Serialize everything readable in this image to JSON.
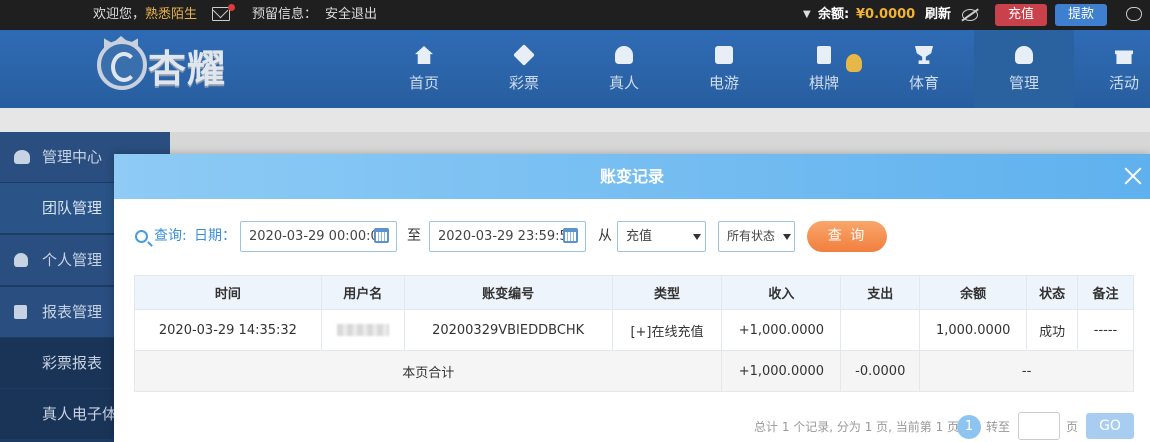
{
  "topbar": {
    "welcome": "欢迎您，",
    "username": "熟悉陌生",
    "reserved_info": "预留信息：",
    "logout": "安全退出",
    "balance_label": "余额:",
    "balance_amount": "¥0.0000",
    "refresh": "刷新",
    "deposit": "充值",
    "withdraw": "提款"
  },
  "brand": {
    "logo_text": "杏耀"
  },
  "nav": [
    {
      "label": "首页",
      "icon": "home-icon"
    },
    {
      "label": "彩票",
      "icon": "lottery-icon"
    },
    {
      "label": "真人",
      "icon": "live-casino-icon"
    },
    {
      "label": "电游",
      "icon": "slot-game-icon"
    },
    {
      "label": "棋牌",
      "icon": "card-game-icon"
    },
    {
      "label": "体育",
      "icon": "trophy-icon"
    },
    {
      "label": "管理",
      "icon": "users-icon"
    },
    {
      "label": "活动",
      "icon": "gift-icon"
    }
  ],
  "sidebar": {
    "items": [
      {
        "label": "管理中心",
        "icon": "users-icon"
      },
      {
        "label": "团队管理"
      },
      {
        "label": "个人管理",
        "icon": "user-icon"
      },
      {
        "label": "报表管理",
        "icon": "document-icon"
      },
      {
        "label": "彩票报表"
      },
      {
        "label": "真人电子体"
      }
    ]
  },
  "modal": {
    "title": "账变记录",
    "query_label": "查询:",
    "date_label": "日期：",
    "date_from": "2020-03-29 00:00:00",
    "to_label": "至",
    "date_to": "2020-03-29 23:59:59",
    "from_label": "从",
    "type_selected": "充值",
    "status_selected": "所有状态",
    "query_button": "查 询"
  },
  "table": {
    "columns": [
      "时间",
      "用户名",
      "账变编号",
      "类型",
      "收入",
      "支出",
      "余额",
      "状态",
      "备注"
    ],
    "rows": [
      {
        "time": "2020-03-29 14:35:32",
        "username": "",
        "serial": "20200329VBIEDDBCHK",
        "type": "[+]在线充值",
        "income": "+1,000.0000",
        "expense": "",
        "balance": "1,000.0000",
        "status": "成功",
        "note": "-----"
      }
    ],
    "summary": {
      "label": "本页合计",
      "income": "+1,000.0000",
      "expense": "-0.0000",
      "balance": "--"
    }
  },
  "pager": {
    "summary": "总计 1 个记录, 分为 1 页, 当前第 1 页",
    "current_page": "1",
    "goto_label": "转至",
    "page_unit": "页",
    "go_button": "GO"
  },
  "colors": {
    "header_blue": "#2f6bb5",
    "modal_header": "#6fbcf1",
    "query_button": "#f38a4a",
    "income_green": "#4c9a3a"
  }
}
